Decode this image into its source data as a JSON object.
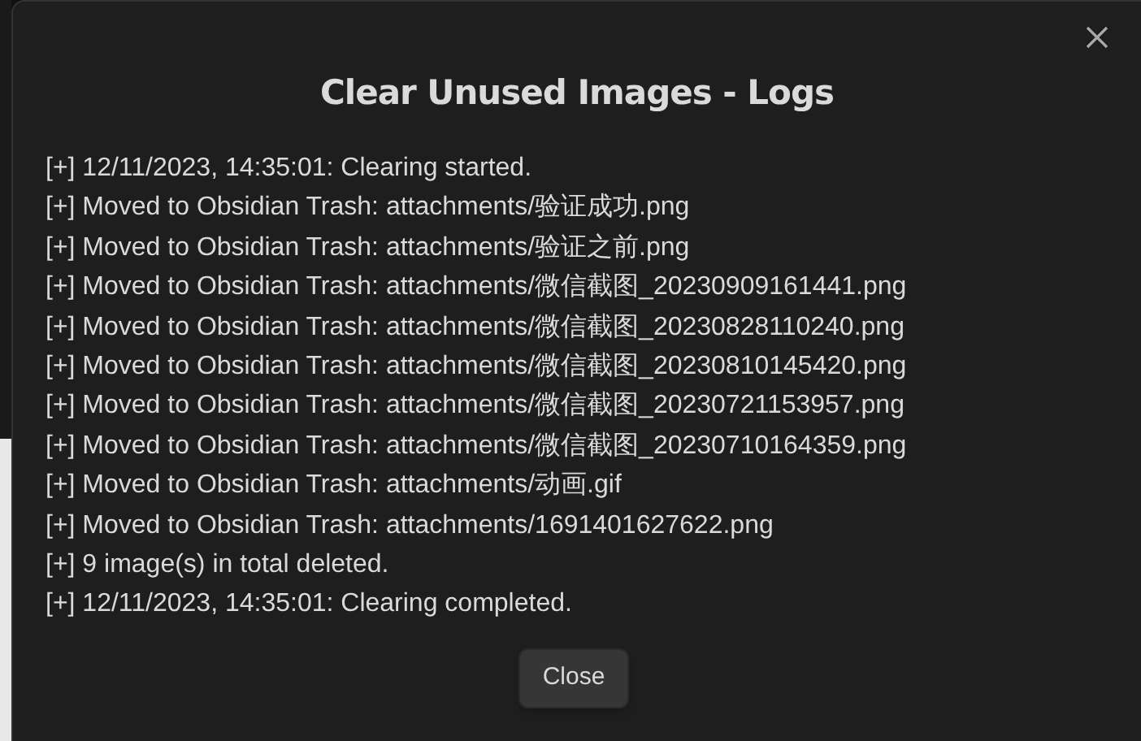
{
  "modal": {
    "title": "Clear Unused Images - Logs",
    "log_lines": [
      "[+] 12/11/2023, 14:35:01: Clearing started.",
      "[+] Moved to Obsidian Trash: attachments/验证成功.png",
      "[+] Moved to Obsidian Trash: attachments/验证之前.png",
      "[+] Moved to Obsidian Trash: attachments/微信截图_20230909161441.png",
      "[+] Moved to Obsidian Trash: attachments/微信截图_20230828110240.png",
      "[+] Moved to Obsidian Trash: attachments/微信截图_20230810145420.png",
      "[+] Moved to Obsidian Trash: attachments/微信截图_20230721153957.png",
      "[+] Moved to Obsidian Trash: attachments/微信截图_20230710164359.png",
      "[+] Moved to Obsidian Trash: attachments/动画.gif",
      "[+] Moved to Obsidian Trash: attachments/1691401627622.png",
      "[+] 9 image(s) in total deleted.",
      "[+] 12/11/2023, 14:35:01: Clearing completed."
    ],
    "button": "Close"
  }
}
